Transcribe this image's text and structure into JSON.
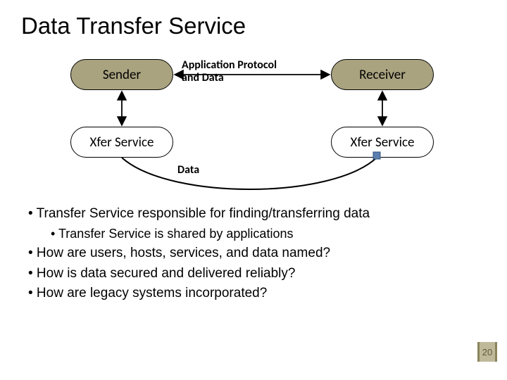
{
  "title": "Data Transfer Service",
  "diagram": {
    "sender": "Sender",
    "receiver": "Receiver",
    "xfer1": "Xfer Service",
    "xfer2": "Xfer Service",
    "label_app_line1": "Application Protocol",
    "label_app_line2": "and Data",
    "label_data": "Data"
  },
  "bullets": {
    "b1": "• Transfer Service responsible for finding/transferring data",
    "b2": "• Transfer Service is shared by applications",
    "b3": "• How are users, hosts, services, and data named?",
    "b4": "• How is data secured and delivered reliably?",
    "b5": "• How are legacy systems incorporated?"
  },
  "page_number": "20"
}
